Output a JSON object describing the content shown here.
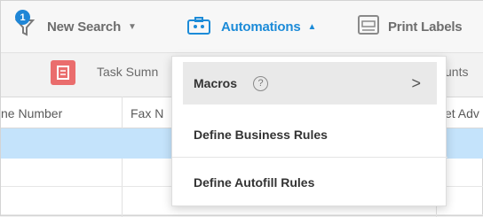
{
  "toolbar": {
    "badge_count": "1",
    "new_search_label": "New Search",
    "automations_label": "Automations",
    "print_labels_label": "Print Labels"
  },
  "subbar": {
    "task_summary_label": "Task Sumn",
    "right_label": "unts"
  },
  "table": {
    "headers": [
      "ne Number",
      "Fax N",
      "et Adv"
    ]
  },
  "dropdown": {
    "items": [
      {
        "label": "Macros",
        "help": "?",
        "chevron": ">"
      },
      {
        "label": "Define Business Rules"
      },
      {
        "label": "Define Autofill Rules"
      }
    ]
  },
  "colors": {
    "accent": "#1c8bd8",
    "selected_row": "#c4e3fb",
    "task_icon": "#ea6d6d"
  }
}
